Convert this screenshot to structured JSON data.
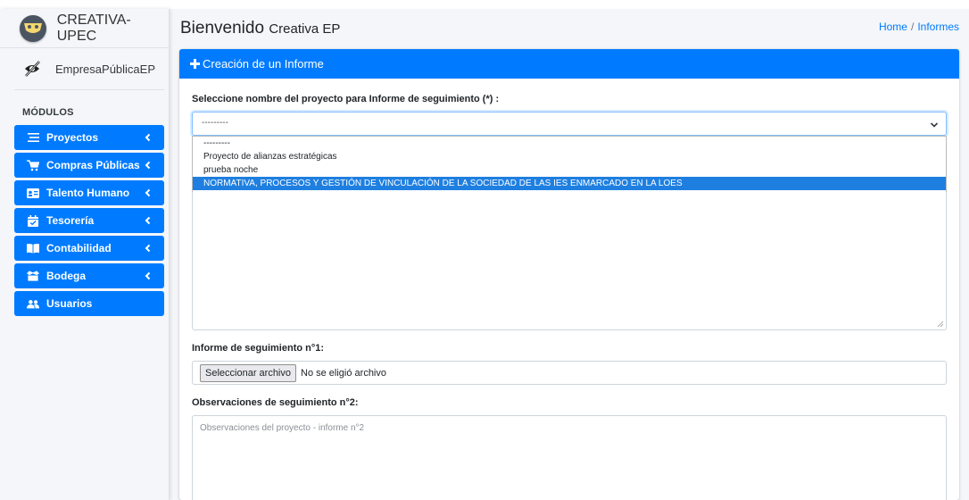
{
  "brand": {
    "name": "CREATIVA-UPEC",
    "logo_icon": "mask-logo-icon"
  },
  "user": {
    "name": "EmpresaPúblicaEP",
    "icon": "eye-slash-icon"
  },
  "sidebar": {
    "section_label": "MÓDULOS",
    "items": [
      {
        "label": "Proyectos",
        "icon": "list-icon",
        "has_chevron": true
      },
      {
        "label": "Compras Públicas",
        "icon": "cart-icon",
        "has_chevron": true
      },
      {
        "label": "Talento Humano",
        "icon": "id-card-icon",
        "has_chevron": true
      },
      {
        "label": "Tesorería",
        "icon": "calendar-check-icon",
        "has_chevron": true
      },
      {
        "label": "Contabilidad",
        "icon": "book-icon",
        "has_chevron": true
      },
      {
        "label": "Bodega",
        "icon": "boxes-icon",
        "has_chevron": true
      },
      {
        "label": "Usuarios",
        "icon": "users-icon",
        "has_chevron": false
      }
    ]
  },
  "header": {
    "title": "Bienvenido",
    "subtitle": "Creativa EP"
  },
  "breadcrumb": {
    "home": "Home",
    "separator": "/",
    "current": "Informes"
  },
  "card": {
    "title": "Creación de un Informe",
    "project_label": "Seleccione nombre del proyecto para Informe de seguimiento (*) :",
    "project_select_value": "---------",
    "project_options": [
      "---------",
      "Proyecto de alianzas estratégicas",
      "prueba noche",
      "NORMATIVA, PROCESOS Y GESTIÓN DE VINCULACIÓN DE LA SOCIEDAD DE LAS IES ENMARCADO EN LA LOES"
    ],
    "selected_option_index": 3,
    "report_label": "Informe de seguimiento n°1:",
    "file_button": "Seleccionar archivo",
    "file_status": "No se eligió archivo",
    "observations_label": "Observaciones de seguimiento n°2:",
    "observations_placeholder": "Observaciones del proyecto - informe n°2"
  },
  "colors": {
    "primary": "#007bff",
    "selected_option": "#1e7fe0",
    "background": "#f4f6f9"
  }
}
